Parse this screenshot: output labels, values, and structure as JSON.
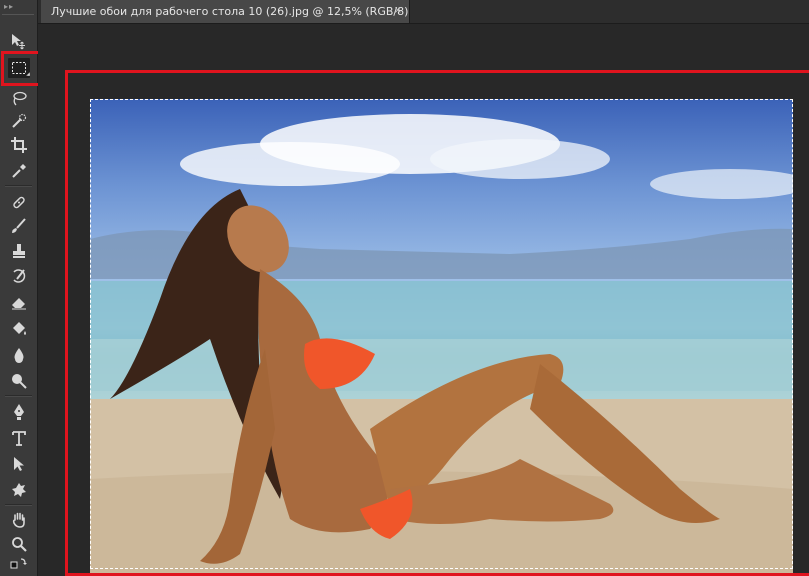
{
  "app": {
    "accent_highlight": "#e0141e"
  },
  "toolbar": {
    "grip_text": "▸▸",
    "tools": [
      {
        "name": "move-tool-icon"
      },
      {
        "name": "rectangular-marquee-tool-icon",
        "selected": true
      },
      {
        "name": "lasso-tool-icon"
      },
      {
        "name": "quick-selection-tool-icon"
      },
      {
        "name": "crop-tool-icon"
      },
      {
        "name": "eyedropper-tool-icon"
      },
      {
        "name": "spot-healing-brush-tool-icon"
      },
      {
        "name": "brush-tool-icon"
      },
      {
        "name": "clone-stamp-tool-icon"
      },
      {
        "name": "history-brush-tool-icon"
      },
      {
        "name": "eraser-tool-icon"
      },
      {
        "name": "paint-bucket-tool-icon"
      },
      {
        "name": "blur-tool-icon"
      },
      {
        "name": "dodge-tool-icon"
      },
      {
        "name": "pen-tool-icon"
      },
      {
        "name": "type-tool-icon"
      },
      {
        "name": "path-selection-tool-icon"
      },
      {
        "name": "custom-shape-tool-icon"
      },
      {
        "name": "hand-tool-icon"
      },
      {
        "name": "zoom-tool-icon"
      }
    ]
  },
  "document": {
    "tab_title": "Лучшие обои для рабочего стола 10 (26).jpg @ 12,5% (RGB/8)",
    "close_glyph": "×",
    "image_description": "photo"
  }
}
